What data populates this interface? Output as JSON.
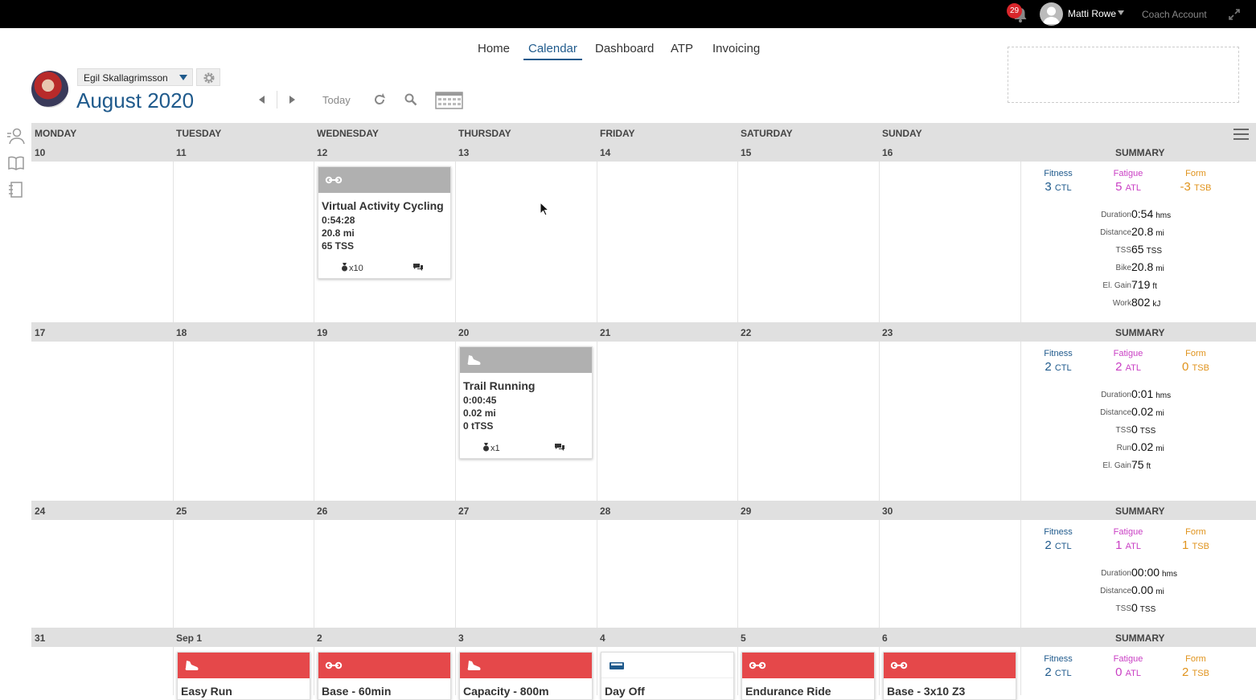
{
  "topbar": {
    "notification_count": "29",
    "user_name": "Matti Rowe",
    "coach_account": "Coach Account"
  },
  "nav": [
    {
      "label": "Home",
      "active": false
    },
    {
      "label": "Calendar",
      "active": true
    },
    {
      "label": "Dashboard",
      "active": false
    },
    {
      "label": "ATP",
      "active": false
    },
    {
      "label": "Invoicing",
      "active": false
    }
  ],
  "header": {
    "athlete_name": "Egil Skallagrimsson",
    "month": "August",
    "year": "2020",
    "today_label": "Today"
  },
  "days_of_week": [
    "MONDAY",
    "TUESDAY",
    "WEDNESDAY",
    "THURSDAY",
    "FRIDAY",
    "SATURDAY",
    "SUNDAY"
  ],
  "summary_label": "SUMMARY",
  "weeks": [
    {
      "dates": [
        "10",
        "11",
        "12",
        "13",
        "14",
        "15",
        "16"
      ],
      "summary": {
        "fitness": {
          "label": "Fitness",
          "value": "3",
          "unit": "CTL"
        },
        "fatigue": {
          "label": "Fatigue",
          "value": "5",
          "unit": "ATL"
        },
        "form": {
          "label": "Form",
          "value": "-3",
          "unit": "TSB"
        },
        "stats": [
          {
            "key": "Duration",
            "value": "0:54",
            "unit": "hms"
          },
          {
            "key": "Distance",
            "value": "20.8",
            "unit": "mi"
          },
          {
            "key": "TSS",
            "value": "65",
            "unit": "TSS"
          },
          {
            "key": "Bike",
            "value": "20.8",
            "unit": "mi"
          },
          {
            "key": "El. Gain",
            "value": "719",
            "unit": "ft"
          },
          {
            "key": "Work",
            "value": "802",
            "unit": "kJ"
          }
        ]
      },
      "workouts": [
        {
          "day": 2,
          "sport": "bike-icon",
          "title": "Virtual Activity Cycling",
          "duration": "0:54:28",
          "distance": "20.8 mi",
          "tss": "65 TSS",
          "medals": "x10"
        }
      ]
    },
    {
      "dates": [
        "17",
        "18",
        "19",
        "20",
        "21",
        "22",
        "23"
      ],
      "summary": {
        "fitness": {
          "label": "Fitness",
          "value": "2",
          "unit": "CTL"
        },
        "fatigue": {
          "label": "Fatigue",
          "value": "2",
          "unit": "ATL"
        },
        "form": {
          "label": "Form",
          "value": "0",
          "unit": "TSB"
        },
        "stats": [
          {
            "key": "Duration",
            "value": "0:01",
            "unit": "hms"
          },
          {
            "key": "Distance",
            "value": "0.02",
            "unit": "mi"
          },
          {
            "key": "TSS",
            "value": "0",
            "unit": "TSS"
          },
          {
            "key": "Run",
            "value": "0.02",
            "unit": "mi"
          },
          {
            "key": "El. Gain",
            "value": "75",
            "unit": "ft"
          }
        ]
      },
      "workouts": [
        {
          "day": 3,
          "sport": "shoe-icon",
          "title": "Trail Running",
          "duration": "0:00:45",
          "distance": "0.02 mi",
          "tss": "0 tTSS",
          "medals": "x1"
        }
      ]
    },
    {
      "dates": [
        "24",
        "25",
        "26",
        "27",
        "28",
        "29",
        "30"
      ],
      "summary": {
        "fitness": {
          "label": "Fitness",
          "value": "2",
          "unit": "CTL"
        },
        "fatigue": {
          "label": "Fatigue",
          "value": "1",
          "unit": "ATL"
        },
        "form": {
          "label": "Form",
          "value": "1",
          "unit": "TSB"
        },
        "stats": [
          {
            "key": "Duration",
            "value": "00:00",
            "unit": "hms"
          },
          {
            "key": "Distance",
            "value": "0.00",
            "unit": "mi"
          },
          {
            "key": "TSS",
            "value": "0",
            "unit": "TSS"
          }
        ]
      },
      "workouts": []
    },
    {
      "dates": [
        "31",
        "Sep 1",
        "2",
        "3",
        "4",
        "5",
        "6"
      ],
      "summary": {
        "fitness": {
          "label": "Fitness",
          "value": "2",
          "unit": "CTL"
        },
        "fatigue": {
          "label": "Fatigue",
          "value": "0",
          "unit": "ATL"
        },
        "form": {
          "label": "Form",
          "value": "2",
          "unit": "TSB"
        },
        "stats": []
      },
      "workouts": [
        {
          "day": 1,
          "sport": "shoe-icon",
          "title": "Easy Run",
          "planned": true
        },
        {
          "day": 2,
          "sport": "bike-icon",
          "title": "Base - 60min",
          "planned": true
        },
        {
          "day": 3,
          "sport": "shoe-icon",
          "title": "Capacity - 800m",
          "planned": true
        },
        {
          "day": 4,
          "sport": "bed-icon",
          "title": "Day Off",
          "planned": false,
          "off": true
        },
        {
          "day": 5,
          "sport": "bike-icon",
          "title": "Endurance Ride",
          "planned": true
        },
        {
          "day": 6,
          "sport": "bike-icon",
          "title": "Base - 3x10 Z3",
          "planned": true
        }
      ]
    }
  ],
  "colors": {
    "accent": "#1f5a8c",
    "fatigue": "#c93fc4",
    "form": "#e0931c",
    "planned": "#e5484a",
    "completed": "#b0b0b0",
    "badge": "#d9262b"
  }
}
